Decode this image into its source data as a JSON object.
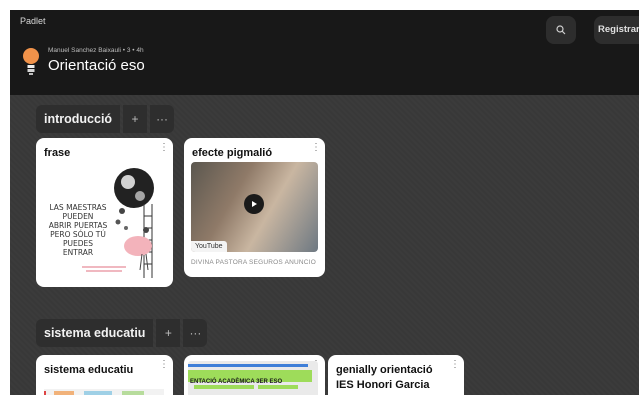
{
  "app": {
    "brand": "Padlet"
  },
  "header": {
    "meta": "Manuel Sanchez Baixauli • 3 • 4h",
    "title": "Orientació eso",
    "register_label": "Registrarse",
    "search_icon": "search-icon",
    "avatar_icon": "lightbulb-icon"
  },
  "sections": [
    {
      "title": "introducció",
      "add_label": "+",
      "more_label": "···",
      "cards": [
        {
          "title": "frase",
          "note_lines": [
            "LAS MAESTRAS",
            "PUEDEN",
            "ABRIR PUERTAS",
            "PERO SÓLO TÚ",
            "PUEDES",
            "ENTRAR"
          ]
        },
        {
          "title": "efecte pigmalió",
          "source": "YouTube",
          "caption": "DIVINA PASTORA SEGUROS ANUNCIO"
        }
      ]
    },
    {
      "title": "sistema educatiu",
      "add_label": "+",
      "more_label": "···",
      "cards": [
        {
          "title": "sistema educatiu"
        },
        {
          "title": "",
          "banner_text": "ENTACIÓ ACADÈMICA 3ER ESO"
        },
        {
          "title": "genially orientació IES Honori Garcia"
        }
      ]
    }
  ],
  "colors": {
    "topbar": "#181818",
    "background": "#3a3a3a",
    "card": "#ffffff",
    "accent_green": "#9edc5a"
  }
}
